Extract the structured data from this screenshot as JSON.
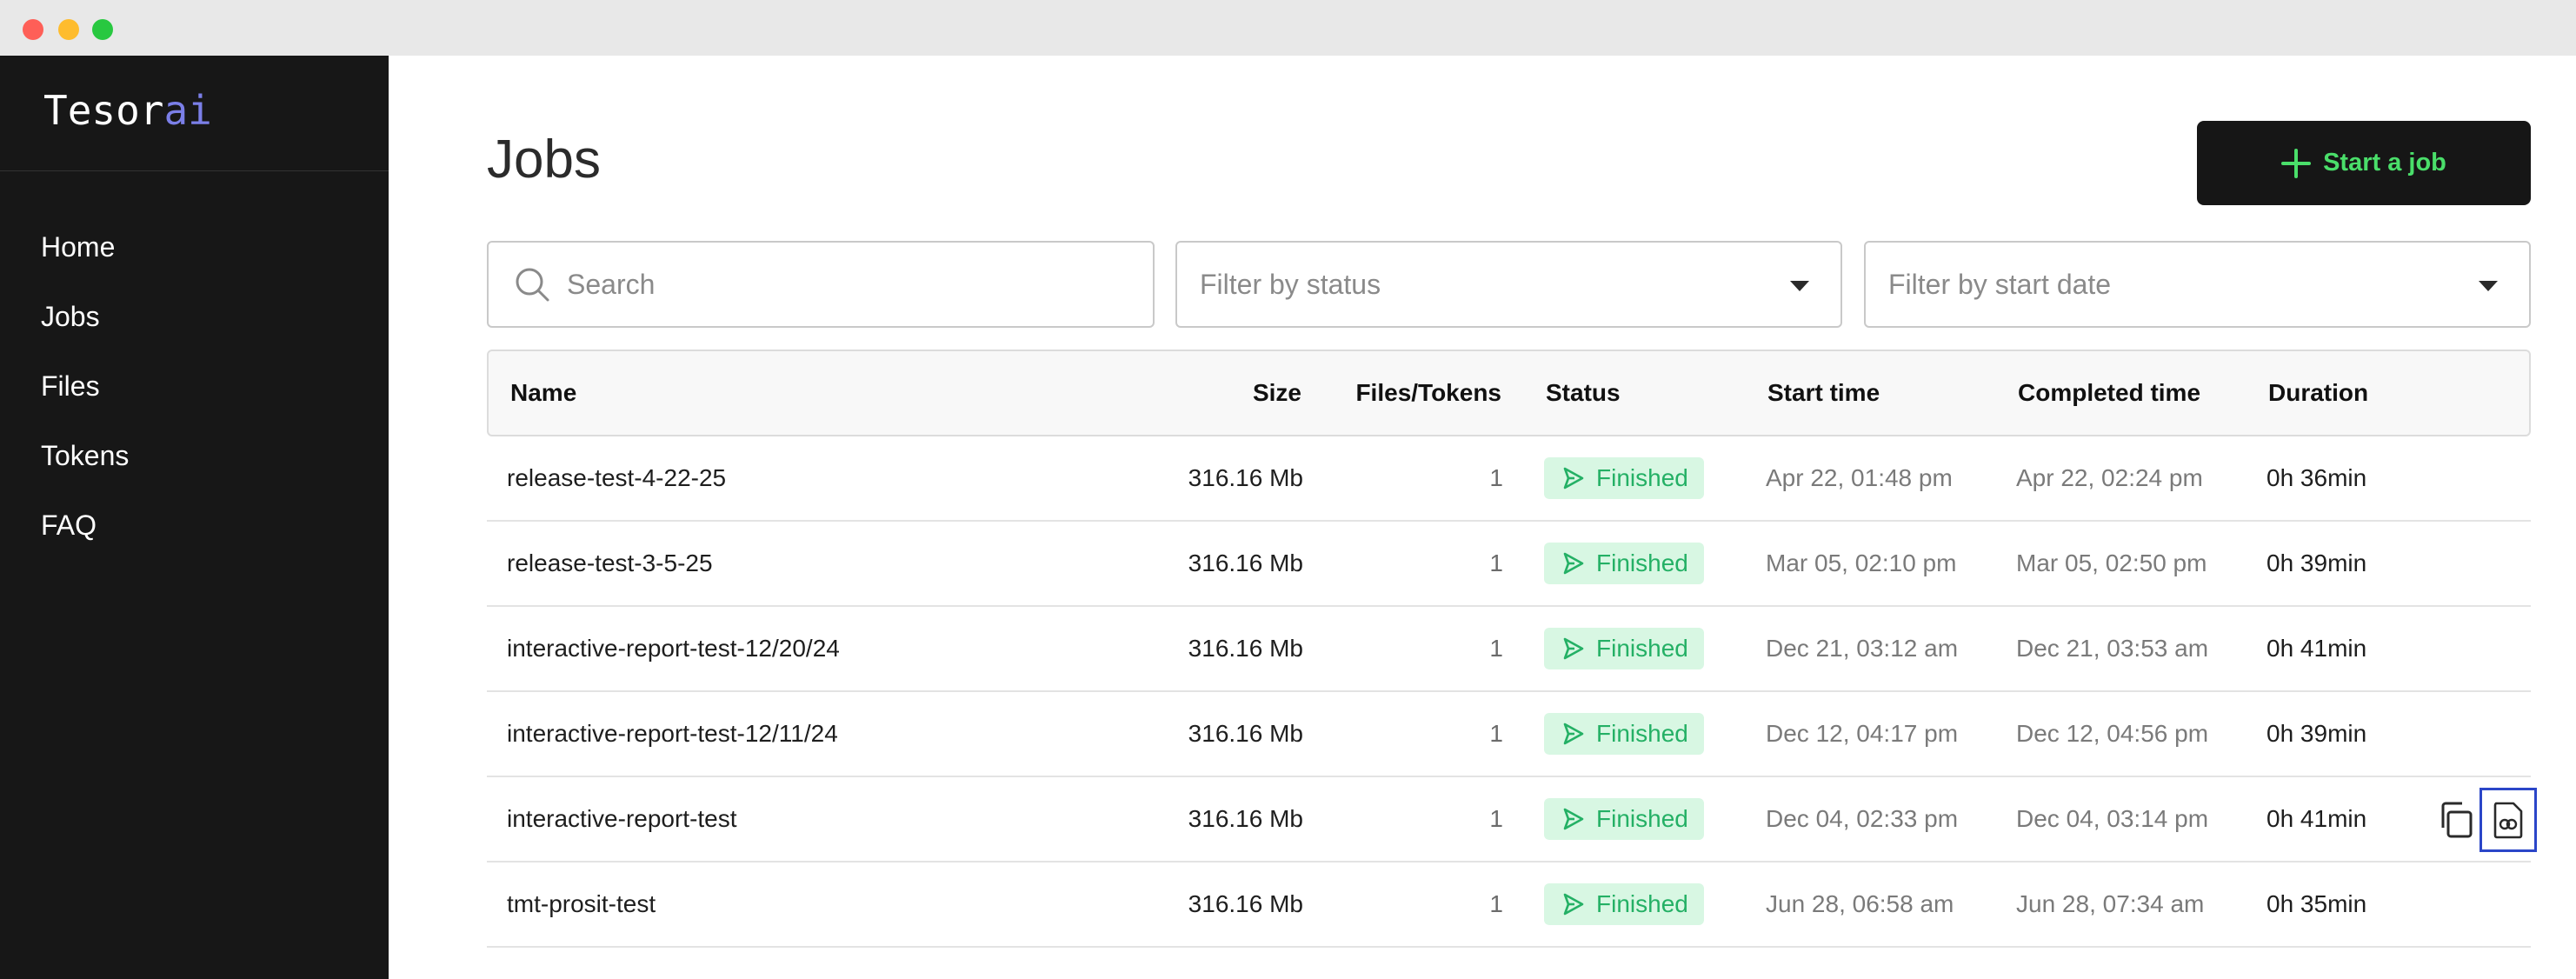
{
  "app": {
    "logo_main": "Tesor",
    "logo_accent": "ai"
  },
  "sidebar": {
    "items": [
      {
        "label": "Home"
      },
      {
        "label": "Jobs"
      },
      {
        "label": "Files"
      },
      {
        "label": "Tokens"
      },
      {
        "label": "FAQ"
      }
    ]
  },
  "header": {
    "title": "Jobs",
    "start_button_label": "Start a job"
  },
  "filters": {
    "search_placeholder": "Search",
    "status_placeholder": "Filter by status",
    "date_placeholder": "Filter by start date"
  },
  "table": {
    "columns": {
      "name": "Name",
      "size": "Size",
      "files": "Files/Tokens",
      "status": "Status",
      "start": "Start time",
      "completed": "Completed time",
      "duration": "Duration"
    },
    "rows": [
      {
        "name": "release-test-4-22-25",
        "size": "316.16 Mb",
        "files": "1",
        "status": "Finished",
        "start": "Apr 22, 01:48 pm",
        "completed": "Apr 22, 02:24 pm",
        "duration": "0h 36min"
      },
      {
        "name": "release-test-3-5-25",
        "size": "316.16 Mb",
        "files": "1",
        "status": "Finished",
        "start": "Mar 05, 02:10 pm",
        "completed": "Mar 05, 02:50 pm",
        "duration": "0h 39min"
      },
      {
        "name": "interactive-report-test-12/20/24",
        "size": "316.16 Mb",
        "files": "1",
        "status": "Finished",
        "start": "Dec 21, 03:12 am",
        "completed": "Dec 21, 03:53 am",
        "duration": "0h 41min"
      },
      {
        "name": "interactive-report-test-12/11/24",
        "size": "316.16 Mb",
        "files": "1",
        "status": "Finished",
        "start": "Dec 12, 04:17 pm",
        "completed": "Dec 12, 04:56 pm",
        "duration": "0h 39min"
      },
      {
        "name": "interactive-report-test",
        "size": "316.16 Mb",
        "files": "1",
        "status": "Finished",
        "start": "Dec 04, 02:33 pm",
        "completed": "Dec 04, 03:14 pm",
        "duration": "0h 41min"
      },
      {
        "name": "tmt-prosit-test",
        "size": "316.16 Mb",
        "files": "1",
        "status": "Finished",
        "start": "Jun 28, 06:58 am",
        "completed": "Jun 28, 07:34 am",
        "duration": "0h 35min"
      }
    ]
  },
  "colors": {
    "sidebar_bg": "#171717",
    "accent_green": "#4ade6a",
    "status_green": "#24b065",
    "status_bg": "#d8f7e3",
    "logo_accent": "#7b7fe8",
    "focus_blue": "#2b46c8"
  },
  "icons": [
    "search-icon",
    "chevron-down-icon",
    "plus-icon",
    "play-icon",
    "copy-icon",
    "report-icon"
  ]
}
